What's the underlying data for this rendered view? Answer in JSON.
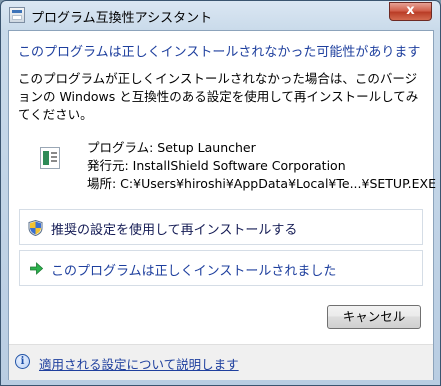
{
  "window": {
    "title": "プログラム互換性アシスタント",
    "close_glyph": "x"
  },
  "dialog": {
    "headline": "このプログラムは正しくインストールされなかった可能性があります",
    "body": "このプログラムが正しくインストールされなかった場合は、このバージョンの Windows と互換性のある設定を使用して再インストールしてみてください。",
    "program_line": "プログラム: Setup Launcher",
    "publisher_line": "発行元: InstallShield Software Corporation",
    "location_line": "場所: C:¥Users¥hiroshi¥AppData¥Local¥Te...¥SETUP.EXE"
  },
  "options": [
    {
      "label": "推奨の設定を使用して再インストールする",
      "icon": "uac-shield-icon"
    },
    {
      "label": "このプログラムは正しくインストールされました",
      "icon": "green-arrow-icon"
    }
  ],
  "buttons": {
    "cancel": "キャンセル"
  },
  "footer": {
    "link": "適用される設定について説明します",
    "icon_glyph": "i"
  },
  "colors": {
    "link_blue": "#1e3f9e",
    "arrow_green": "#2bb24c",
    "close_red": "#c7503a"
  }
}
